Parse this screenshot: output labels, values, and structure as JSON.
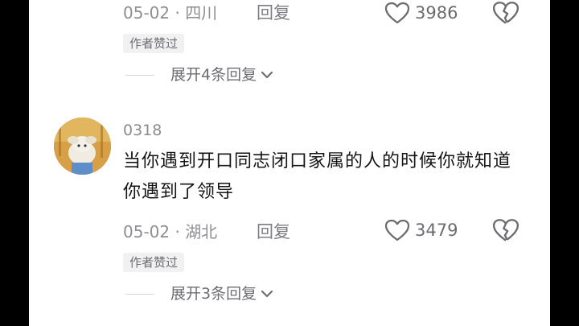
{
  "comments": [
    {
      "meta": "05-02 · 四川",
      "reply_label": "回复",
      "like_count": "3986",
      "author_liked_badge": "作者赞过",
      "expand_label": "展开4条回复"
    },
    {
      "username": "0318",
      "text": "当你遇到开口同志闭口家属的人的时候你就知道你遇到了领导",
      "meta": "05-02 · 湖北",
      "reply_label": "回复",
      "like_count": "3479",
      "author_liked_badge": "作者赞过",
      "expand_label": "展开3条回复"
    }
  ],
  "icons": {
    "like": "heart-outline-icon",
    "dislike": "broken-heart-icon",
    "expand": "chevron-down-icon"
  },
  "colors": {
    "background": "#ffffff",
    "text_primary": "#151515",
    "text_secondary": "#8e8e93",
    "badge_bg": "#f1f1f1"
  }
}
